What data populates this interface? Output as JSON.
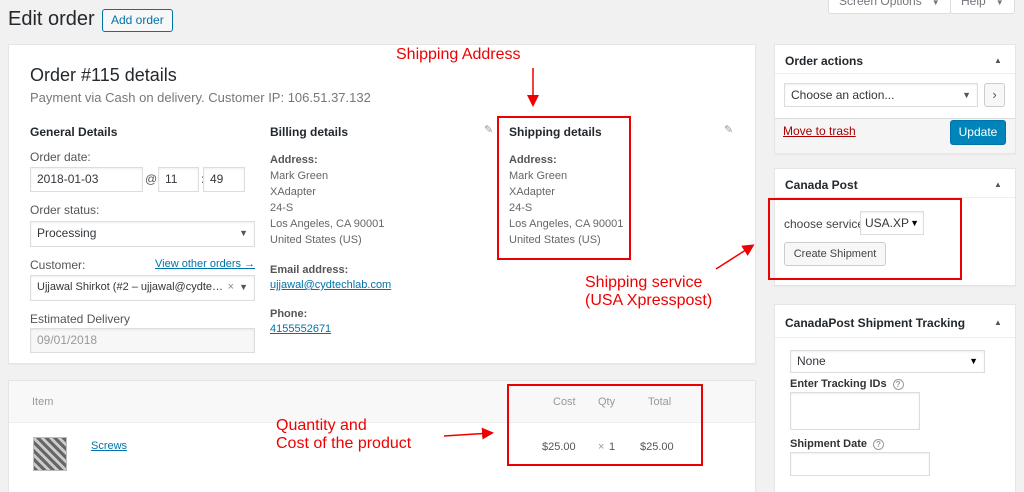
{
  "header": {
    "title": "Edit order",
    "add_order": "Add order",
    "screen_options": "Screen Options",
    "help": "Help"
  },
  "order": {
    "title": "Order #115 details",
    "subtitle": "Payment via Cash on delivery. Customer IP: 106.51.37.132"
  },
  "general": {
    "heading": "General Details",
    "order_date_label": "Order date:",
    "order_date": "2018-01-03",
    "at": "@",
    "hour": "11",
    "colon": ":",
    "minute": "49",
    "status_label": "Order status:",
    "status": "Processing",
    "customer_label": "Customer:",
    "view_other_orders": "View other orders →",
    "customer": "Ujjawal Shirkot (#2 – ujjawal@cydte…",
    "clear": "×",
    "est_delivery_label": "Estimated Delivery",
    "est_delivery": "09/01/2018"
  },
  "billing": {
    "heading": "Billing details",
    "address_label": "Address:",
    "address_lines": [
      "Mark Green",
      "XAdapter",
      "24-S",
      "Los Angeles, CA 90001",
      "United States (US)"
    ],
    "email_label": "Email address:",
    "email": "ujjawal@cydtechlab.com",
    "phone_label": "Phone:",
    "phone": "4155552671"
  },
  "shipping": {
    "heading": "Shipping details",
    "address_label": "Address:",
    "address_lines": [
      "Mark Green",
      "XAdapter",
      "24-S",
      "Los Angeles, CA 90001",
      "United States (US)"
    ]
  },
  "items": {
    "col_item": "Item",
    "col_cost": "Cost",
    "col_qty": "Qty",
    "col_total": "Total",
    "rows": [
      {
        "name": "Screws",
        "cost": "$25.00",
        "qty_x": "×",
        "qty": "1",
        "total": "$25.00"
      }
    ]
  },
  "order_actions": {
    "heading": "Order actions",
    "select": "Choose an action...",
    "go": "›",
    "trash": "Move to trash",
    "update": "Update"
  },
  "canada_post": {
    "heading": "Canada Post",
    "choose_label": "choose service:",
    "service": "USA.XP",
    "create": "Create Shipment"
  },
  "tracking": {
    "heading": "CanadaPost Shipment Tracking",
    "carrier": "None",
    "ids_label": "Enter Tracking IDs",
    "date_label": "Shipment Date",
    "help": "?"
  },
  "annotations": {
    "shipping_address": "Shipping Address",
    "shipping_service_1": "Shipping service",
    "shipping_service_2": "(USA Xpresspost)",
    "qty_cost_1": "Quantity and",
    "qty_cost_2": "Cost of the product"
  },
  "icons": {
    "caret_up": "▲",
    "caret_down": "▼",
    "pencil": "✎"
  },
  "colors": {
    "accent": "#0073aa",
    "primary_button": "#0085ba",
    "annotation_red": "#e00000"
  }
}
